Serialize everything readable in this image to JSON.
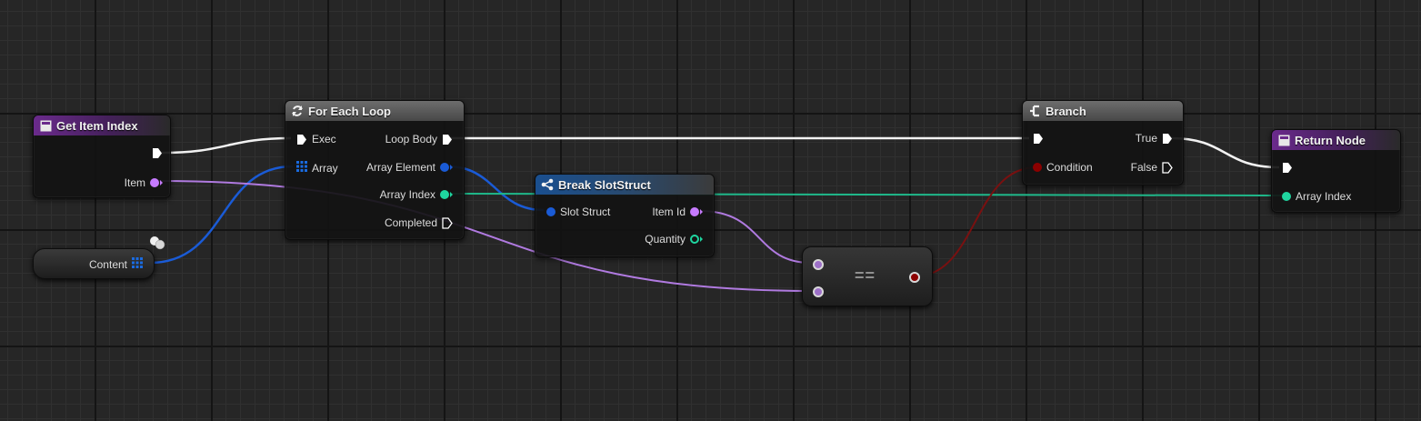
{
  "nodes": {
    "get_item_index": {
      "title": "Get Item Index",
      "pin_item": "Item"
    },
    "content": {
      "label": "Content"
    },
    "for_each_loop": {
      "title": "For Each Loop",
      "pin_exec": "Exec",
      "pin_array": "Array",
      "pin_loop_body": "Loop Body",
      "pin_array_element": "Array Element",
      "pin_array_index": "Array Index",
      "pin_completed": "Completed"
    },
    "break_slot_struct": {
      "title": "Break SlotStruct",
      "pin_slot_struct": "Slot Struct",
      "pin_item_id": "Item Id",
      "pin_quantity": "Quantity"
    },
    "equals": {
      "label": "=="
    },
    "branch": {
      "title": "Branch",
      "pin_condition": "Condition",
      "pin_true": "True",
      "pin_false": "False"
    },
    "return_node": {
      "title": "Return Node",
      "pin_array_index": "Array Index"
    }
  },
  "colors": {
    "exec": "#ffffff",
    "int": "#1fd6a0",
    "struct": "#1a5bd6",
    "bool": "#8c0000",
    "name": "#c77bff",
    "function_header": "#6a2a8c",
    "macro_header": "#5a5a5a",
    "pure_header": "#1a4f8f",
    "background": "#262626"
  },
  "icons": {
    "function": "function-icon",
    "macro": "loop-macro-icon",
    "break": "break-struct-icon",
    "branch": "branch-icon"
  }
}
